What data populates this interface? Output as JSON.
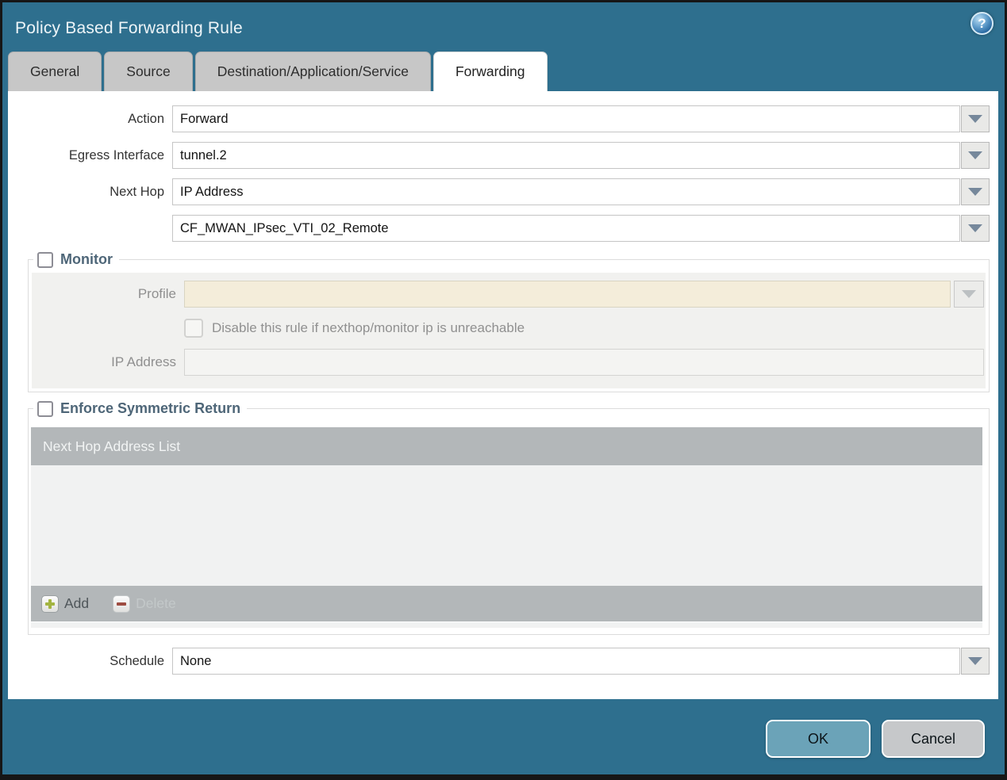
{
  "window": {
    "title": "Policy Based Forwarding Rule"
  },
  "icons": {
    "help_glyph": "?"
  },
  "tabs": [
    {
      "label": "General",
      "active": false
    },
    {
      "label": "Source",
      "active": false
    },
    {
      "label": "Destination/Application/Service",
      "active": false
    },
    {
      "label": "Forwarding",
      "active": true
    }
  ],
  "form": {
    "action_label": "Action",
    "action_value": "Forward",
    "egress_label": "Egress Interface",
    "egress_value": "tunnel.2",
    "next_hop_label": "Next Hop",
    "next_hop_value": "IP Address",
    "next_hop_address_value": "CF_MWAN_IPsec_VTI_02_Remote",
    "schedule_label": "Schedule",
    "schedule_value": "None"
  },
  "monitor": {
    "legend": "Monitor",
    "checked": false,
    "profile_label": "Profile",
    "profile_value": "",
    "disable_label": "Disable this rule if nexthop/monitor ip is unreachable",
    "disable_checked": false,
    "ip_label": "IP Address",
    "ip_value": ""
  },
  "symmetric_return": {
    "legend": "Enforce Symmetric Return",
    "checked": false,
    "table_header": "Next Hop Address List",
    "rows": [],
    "add_label": "Add",
    "delete_label": "Delete"
  },
  "footer": {
    "ok": "OK",
    "cancel": "Cancel"
  },
  "colors": {
    "titlebar_teal": "#2e6f8e",
    "tab_inactive_gray": "#c7c7c7",
    "section_legend": "#4e6678",
    "disabled_field_beige": "#f4edda",
    "table_header_gray": "#b3b7b9",
    "ok_button": "#6ba3b8",
    "cancel_button": "#c6c8ca",
    "add_plus_green": "#a3b441",
    "delete_minus_red": "#9e4c41"
  }
}
